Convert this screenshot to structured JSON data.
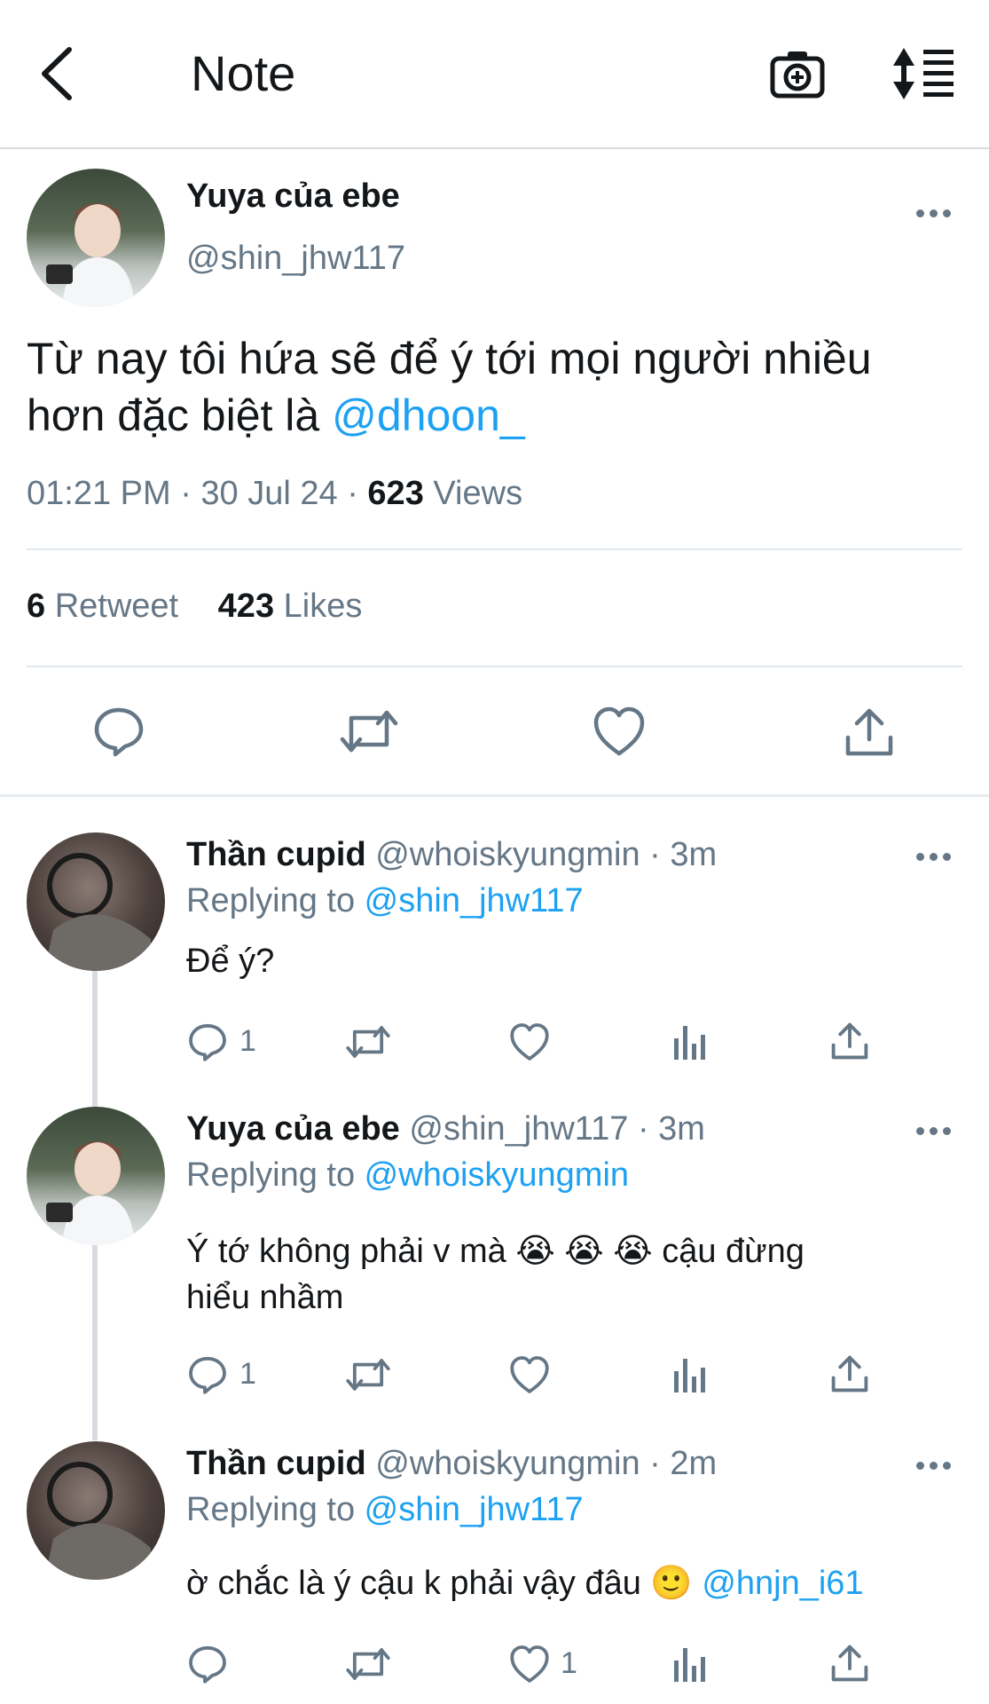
{
  "header": {
    "title": "Note"
  },
  "tweet": {
    "display_name": "Yuya của ebe",
    "handle": "@shin_jhw117",
    "text_line1": "Từ nay tôi hứa sẽ để ý tới mọi người nhiều",
    "text_line2_prefix": "hơn đặc biệt là ",
    "text_mention": "@dhoon_",
    "timestamp": "01:21 PM · 30 Jul 24 · ",
    "views_count": "623",
    "views_label": " Views",
    "retweet_count": "6",
    "retweet_label": " Retweet",
    "likes_count": "423",
    "likes_label": " Likes"
  },
  "replies": [
    {
      "name": "Thần cupid",
      "meta": " @whoiskyungmin · 3m",
      "replying_prefix": "Replying to ",
      "replying_handle": "@shin_jhw117",
      "text": "Để ý?",
      "reply_count": "1",
      "like_count": ""
    },
    {
      "name": "Yuya của ebe",
      "meta": " @shin_jhw117 · 3m",
      "replying_prefix": "Replying to ",
      "replying_handle": "@whoiskyungmin",
      "text_line1": "Ý tớ không phải v mà 😭 😭 😭  cậu đừng",
      "text_line2": "hiểu nhầm",
      "reply_count": "1",
      "like_count": ""
    },
    {
      "name": "Thần cupid",
      "meta": " @whoiskyungmin · 2m",
      "replying_prefix": "Replying to ",
      "replying_handle": "@shin_jhw117",
      "text": "ờ chắc là ý cậu k phải vậy đâu 🙂 ",
      "text_mention": "@hnjn_i61",
      "reply_count": "",
      "like_count": "1"
    }
  ],
  "colors": {
    "accent": "#1da1f2",
    "muted": "#657786",
    "text": "#14171a"
  }
}
